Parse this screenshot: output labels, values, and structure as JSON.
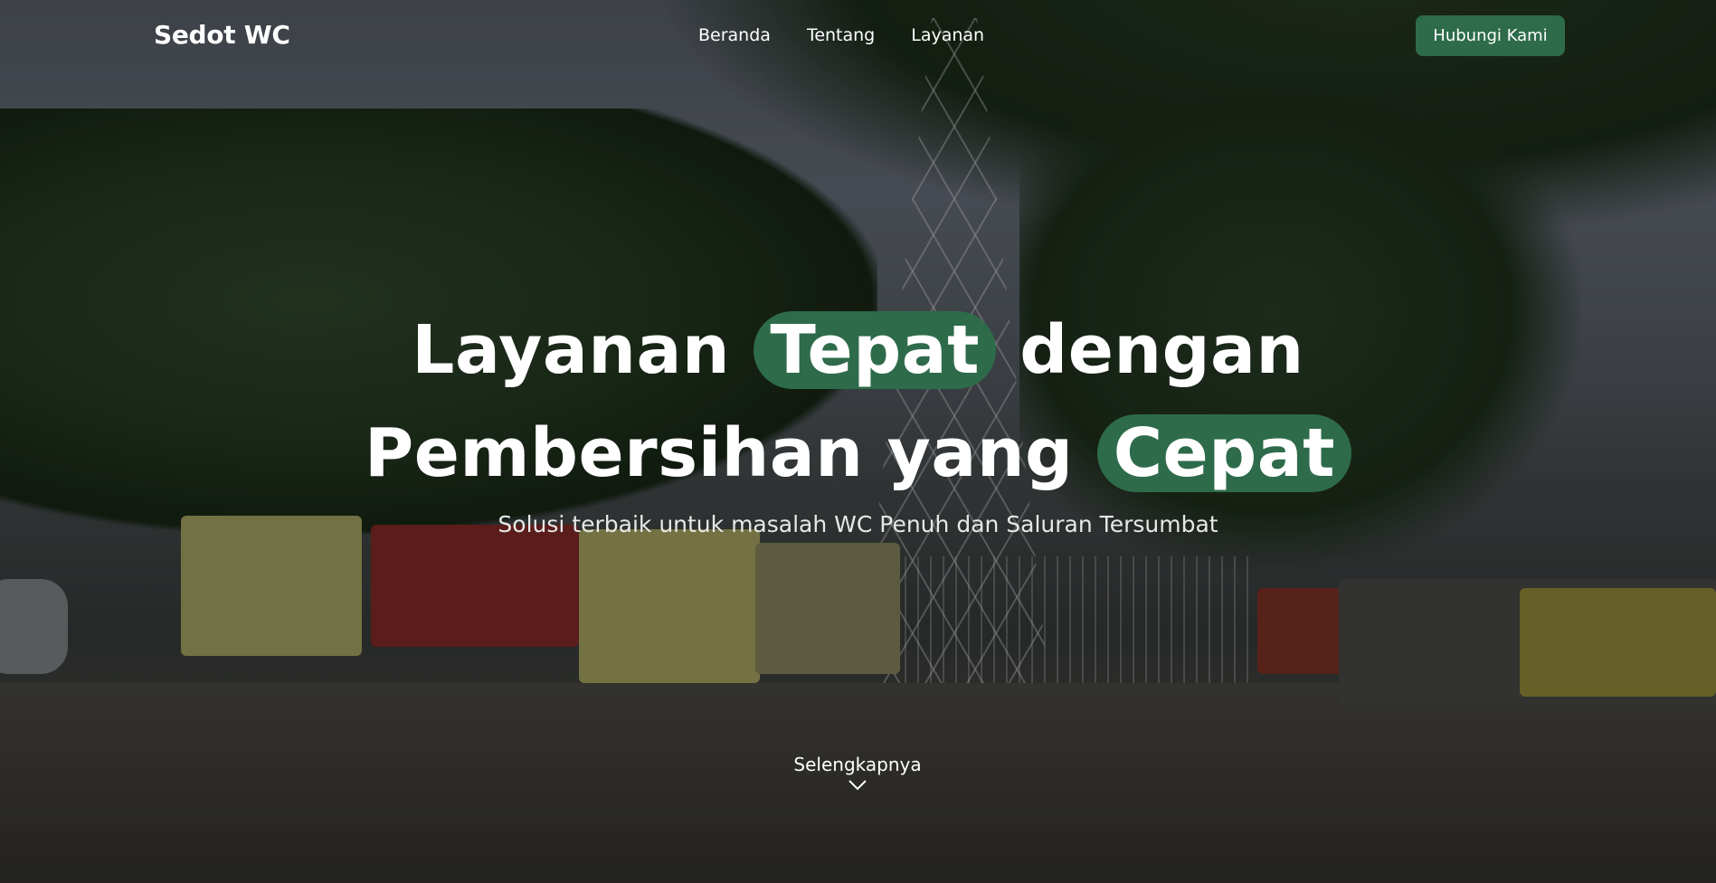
{
  "nav": {
    "logo": "Sedot WC",
    "links": [
      "Beranda",
      "Tentang",
      "Layanan"
    ],
    "cta": "Hubungi Kami"
  },
  "hero": {
    "line1_a": "Layanan",
    "line1_highlight": "Tepat",
    "line1_b": "dengan",
    "line2_a": "Pembersihan yang",
    "line2_highlight": "Cepat",
    "subtitle": "Solusi terbaik untuk masalah WC Penuh dan Saluran Tersumbat",
    "more": "Selengkapnya",
    "more_icon": "chevron-down-icon"
  },
  "colors": {
    "accent": "#2e6b4a",
    "text": "#ffffff"
  }
}
